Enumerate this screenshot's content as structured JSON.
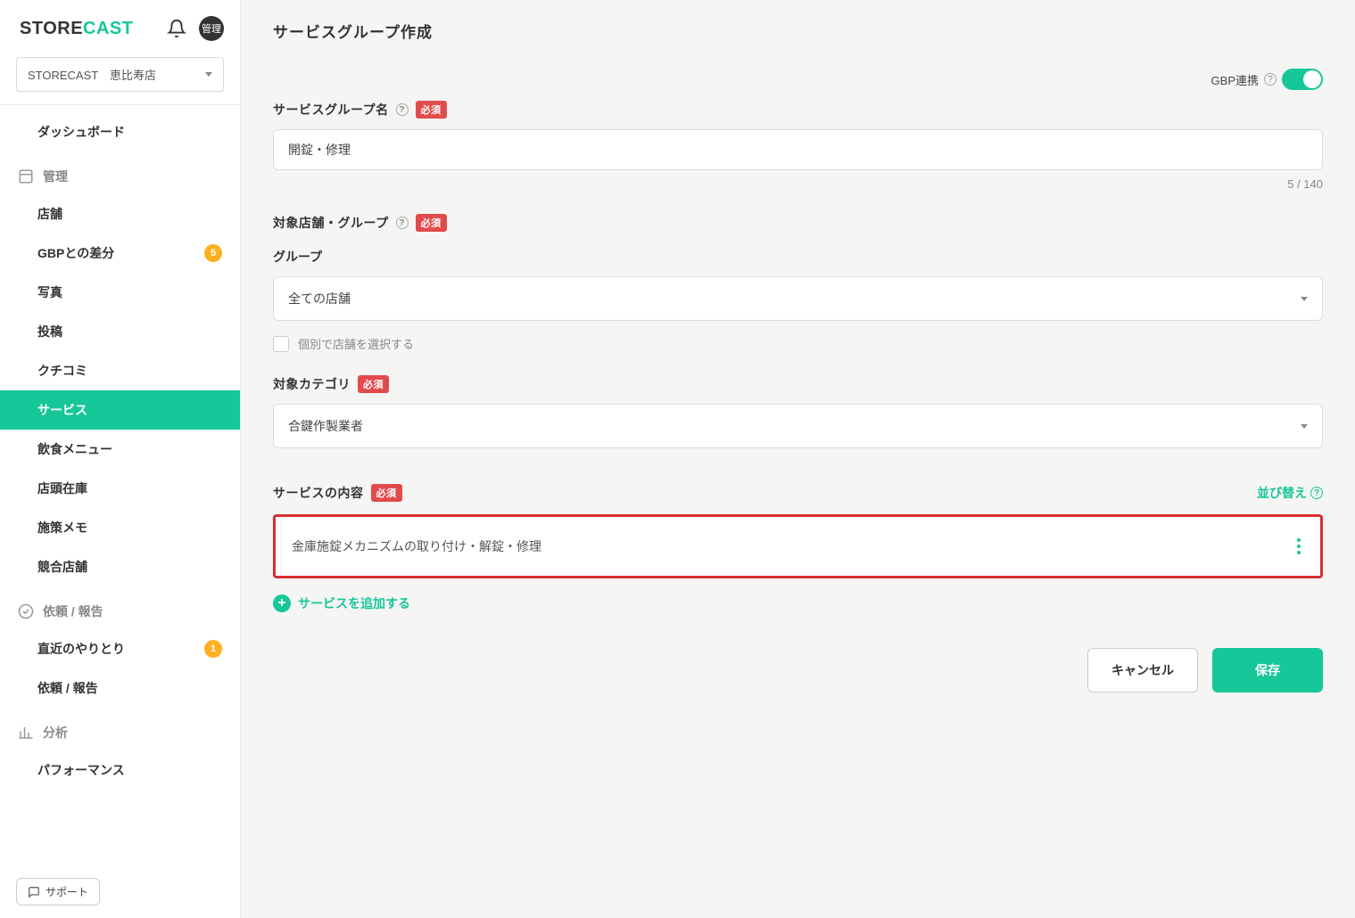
{
  "logo": {
    "store": "STORE",
    "cast": "CAST"
  },
  "avatar_label": "管理",
  "store_selector": {
    "value": "STORECAST　恵比寿店"
  },
  "sidebar": {
    "dashboard": "ダッシュボード",
    "section_manage": "管理",
    "items_manage": [
      {
        "label": "店舗"
      },
      {
        "label": "GBPとの差分",
        "badge": "5"
      },
      {
        "label": "写真"
      },
      {
        "label": "投稿"
      },
      {
        "label": "クチコミ"
      },
      {
        "label": "サービス",
        "active": true
      },
      {
        "label": "飲食メニュー"
      },
      {
        "label": "店頭在庫"
      },
      {
        "label": "施策メモ"
      },
      {
        "label": "競合店舗"
      }
    ],
    "section_request": "依頼 / 報告",
    "items_request": [
      {
        "label": "直近のやりとり",
        "badge": "1"
      },
      {
        "label": "依頼 / 報告"
      }
    ],
    "section_analysis": "分析",
    "items_analysis": [
      {
        "label": "パフォーマンス"
      }
    ]
  },
  "support_label": "サポート",
  "page": {
    "title": "サービスグループ作成",
    "gbp_link_label": "GBP連携",
    "fields": {
      "group_name_label": "サービスグループ名",
      "group_name_value": "開錠・修理",
      "group_name_counter": "5 / 140",
      "target_label": "対象店舗・グループ",
      "group_sublabel": "グループ",
      "group_select_value": "全ての店舗",
      "individual_checkbox_label": "個別で店舗を選択する",
      "category_label": "対象カテゴリ",
      "category_value": "合鍵作製業者",
      "services_label": "サービスの内容",
      "sort_label": "並び替え",
      "service_item_text": "金庫施錠メカニズムの取り付け・解錠・修理",
      "add_service_label": "サービスを追加する"
    },
    "required_tag": "必須",
    "buttons": {
      "cancel": "キャンセル",
      "save": "保存"
    }
  }
}
